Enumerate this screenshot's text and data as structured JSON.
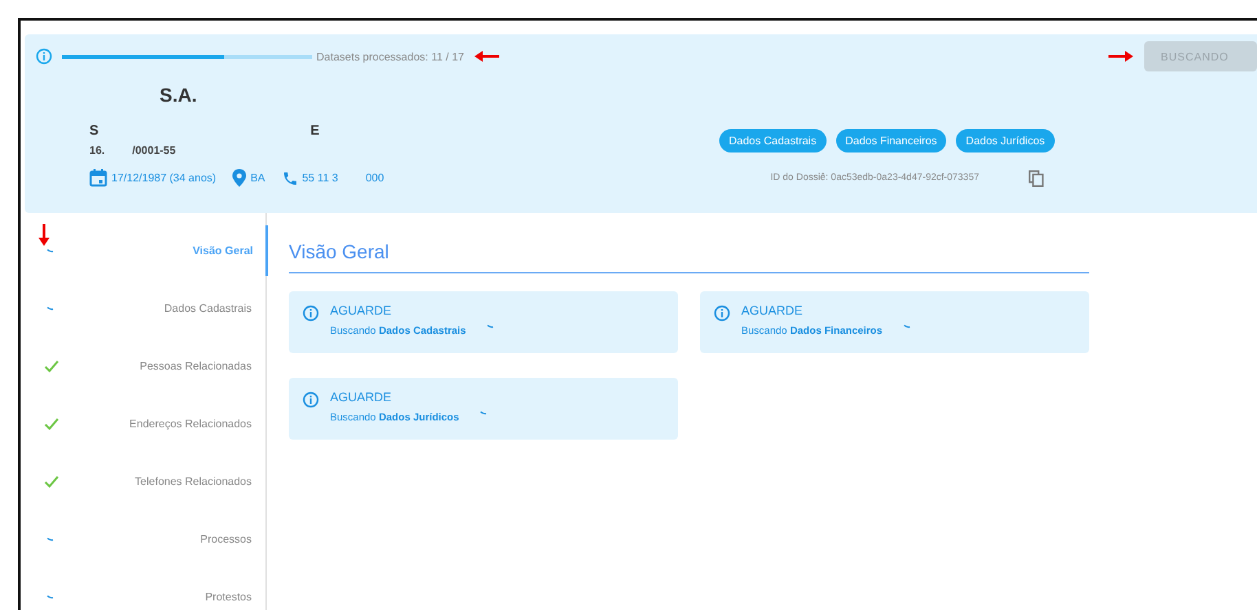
{
  "header": {
    "progress": {
      "level": 0.65,
      "label": "Datasets processados: 11 / 17"
    },
    "search_button": {
      "label": "BUSCANDO",
      "disabled": true
    },
    "company_name": "S.A.",
    "trade_name": [
      "S",
      "E"
    ],
    "document": [
      "16.",
      "/0001-55"
    ],
    "birth_date": "17/12/1987 (34 anos)",
    "state": "BA",
    "phone": [
      "55 11 3",
      "000"
    ],
    "chips": [
      "Dados Cadastrais",
      "Dados Financeiros",
      "Dados Jurídicos"
    ],
    "dossier_id": "ID do Dossiê: 0ac53edb-0a23-4d47-92cf-073357"
  },
  "sidebar": {
    "items": [
      {
        "label": "Visão Geral",
        "kind": "loading",
        "selected": true
      },
      {
        "label": "Dados Cadastrais",
        "kind": "loading",
        "selected": false
      },
      {
        "label": "Pessoas Relacionadas",
        "kind": "done",
        "selected": false
      },
      {
        "label": "Endereços Relacionados",
        "kind": "done",
        "selected": false
      },
      {
        "label": "Telefones Relacionados",
        "kind": "done",
        "selected": false
      },
      {
        "label": "Processos",
        "kind": "loading",
        "selected": false
      },
      {
        "label": "Protestos",
        "kind": "loading",
        "selected": false
      }
    ]
  },
  "main": {
    "title": "Visão Geral",
    "alerts": [
      {
        "title": "AGUARDE",
        "text": "Buscando **Dados Cadastrais**"
      },
      {
        "title": "AGUARDE",
        "text": "Buscando **Dados Financeiros**"
      },
      {
        "title": "AGUARDE",
        "text": "Buscando **Dados Jurídicos**"
      }
    ]
  }
}
